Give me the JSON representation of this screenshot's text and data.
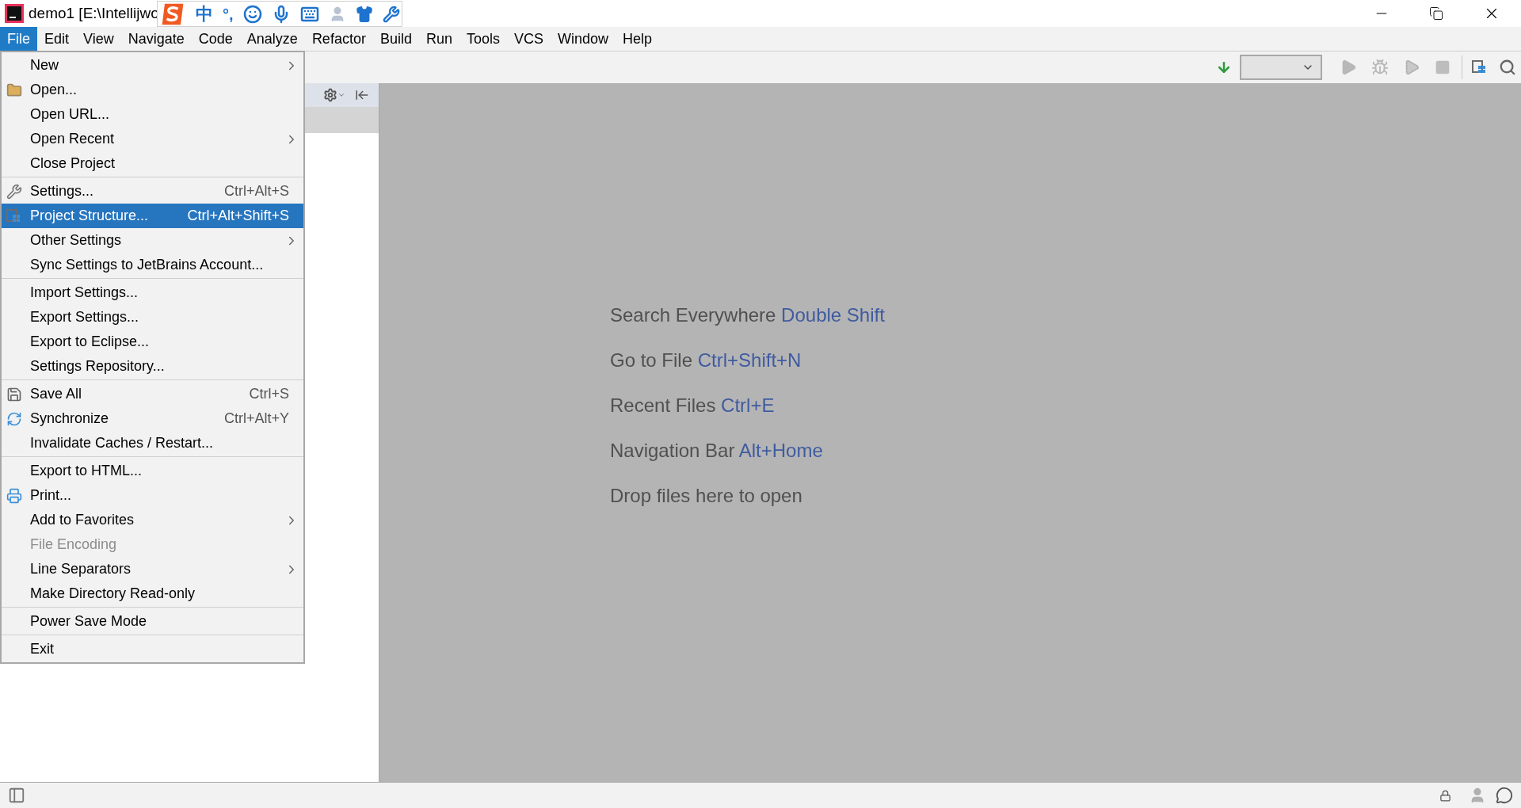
{
  "window": {
    "title": "demo1 [E:\\Intellijwo"
  },
  "ime_toolbar": {
    "mode": "中",
    "punctuation": "°,"
  },
  "menu_bar": [
    {
      "label": "File",
      "selected": true
    },
    {
      "label": "Edit",
      "selected": false
    },
    {
      "label": "View",
      "selected": false
    },
    {
      "label": "Navigate",
      "selected": false
    },
    {
      "label": "Code",
      "selected": false
    },
    {
      "label": "Analyze",
      "selected": false
    },
    {
      "label": "Refactor",
      "selected": false
    },
    {
      "label": "Build",
      "selected": false
    },
    {
      "label": "Run",
      "selected": false
    },
    {
      "label": "Tools",
      "selected": false
    },
    {
      "label": "VCS",
      "selected": false
    },
    {
      "label": "Window",
      "selected": false
    },
    {
      "label": "Help",
      "selected": false
    }
  ],
  "file_menu": {
    "sections": [
      {
        "items": [
          {
            "label": "New",
            "submenu": true,
            "disabled": false,
            "selected": false
          },
          {
            "label": "Open...",
            "submenu": false,
            "disabled": false,
            "selected": false
          },
          {
            "label": "Open URL...",
            "submenu": false,
            "disabled": false,
            "selected": false
          },
          {
            "label": "Open Recent",
            "submenu": true,
            "disabled": false,
            "selected": false
          },
          {
            "label": "Close Project",
            "submenu": false,
            "disabled": false,
            "selected": false
          }
        ]
      },
      {
        "items": [
          {
            "label": "Settings...",
            "shortcut": "Ctrl+Alt+S",
            "submenu": false,
            "disabled": false,
            "selected": false
          },
          {
            "label": "Project Structure...",
            "shortcut": "Ctrl+Alt+Shift+S",
            "submenu": false,
            "disabled": false,
            "selected": true
          },
          {
            "label": "Other Settings",
            "submenu": true,
            "disabled": false,
            "selected": false
          },
          {
            "label": "Sync Settings to JetBrains Account...",
            "submenu": false,
            "disabled": false,
            "selected": false
          }
        ]
      },
      {
        "items": [
          {
            "label": "Import Settings...",
            "submenu": false,
            "disabled": false,
            "selected": false
          },
          {
            "label": "Export Settings...",
            "submenu": false,
            "disabled": false,
            "selected": false
          },
          {
            "label": "Export to Eclipse...",
            "submenu": false,
            "disabled": false,
            "selected": false
          },
          {
            "label": "Settings Repository...",
            "submenu": false,
            "disabled": false,
            "selected": false
          }
        ]
      },
      {
        "items": [
          {
            "label": "Save All",
            "shortcut": "Ctrl+S",
            "submenu": false,
            "disabled": false,
            "selected": false
          },
          {
            "label": "Synchronize",
            "shortcut": "Ctrl+Alt+Y",
            "submenu": false,
            "disabled": false,
            "selected": false
          },
          {
            "label": "Invalidate Caches / Restart...",
            "submenu": false,
            "disabled": false,
            "selected": false
          }
        ]
      },
      {
        "items": [
          {
            "label": "Export to HTML...",
            "submenu": false,
            "disabled": false,
            "selected": false
          },
          {
            "label": "Print...",
            "submenu": false,
            "disabled": false,
            "selected": false
          },
          {
            "label": "Add to Favorites",
            "submenu": true,
            "disabled": false,
            "selected": false
          },
          {
            "label": "File Encoding",
            "submenu": false,
            "disabled": true,
            "selected": false
          },
          {
            "label": "Line Separators",
            "submenu": true,
            "disabled": false,
            "selected": false
          },
          {
            "label": "Make Directory Read-only",
            "submenu": false,
            "disabled": false,
            "selected": false
          }
        ]
      },
      {
        "items": [
          {
            "label": "Power Save Mode",
            "submenu": false,
            "disabled": false,
            "selected": false
          }
        ]
      },
      {
        "items": [
          {
            "label": "Exit",
            "submenu": false,
            "disabled": false,
            "selected": false
          }
        ]
      }
    ]
  },
  "editor_hints": [
    {
      "text": "Search Everywhere",
      "shortcut": "Double Shift"
    },
    {
      "text": "Go to File",
      "shortcut": "Ctrl+Shift+N"
    },
    {
      "text": "Recent Files",
      "shortcut": "Ctrl+E"
    },
    {
      "text": "Navigation Bar",
      "shortcut": "Alt+Home"
    },
    {
      "text": "Drop files here to open"
    }
  ]
}
